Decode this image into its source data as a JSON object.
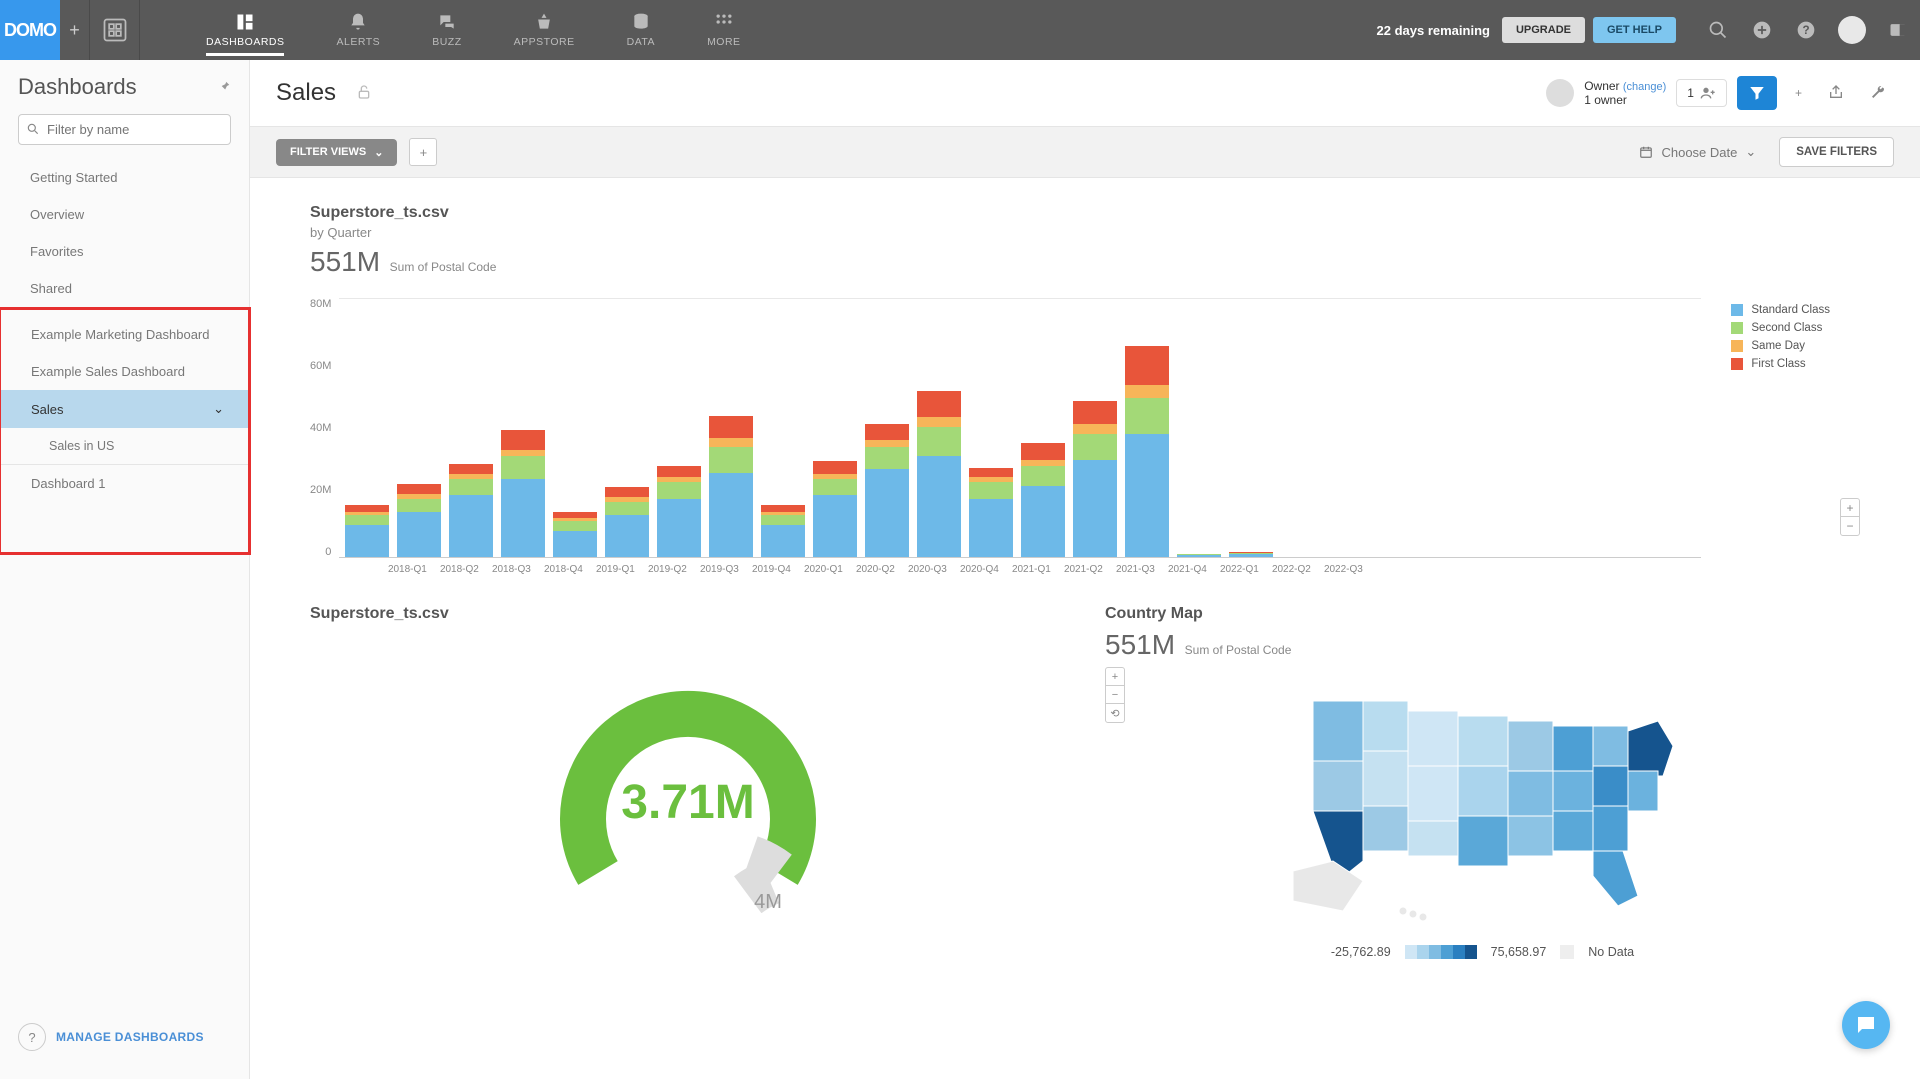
{
  "topnav": {
    "logo": "DOMO",
    "items": [
      "DASHBOARDS",
      "ALERTS",
      "BUZZ",
      "APPSTORE",
      "DATA",
      "MORE"
    ],
    "trial": "22 days remaining",
    "upgrade": "UPGRADE",
    "gethelp": "GET HELP"
  },
  "sidebar": {
    "title": "Dashboards",
    "filter_placeholder": "Filter by name",
    "items_top": [
      "Getting Started",
      "Overview",
      "Favorites",
      "Shared"
    ],
    "items_box": [
      {
        "label": "Example Marketing Dashboard"
      },
      {
        "label": "Example Sales Dashboard"
      },
      {
        "label": "Sales",
        "selected": true,
        "expand": true
      },
      {
        "label": "Sales in US",
        "sub": true
      },
      {
        "label": "Dashboard 1"
      }
    ],
    "manage": "MANAGE DASHBOARDS"
  },
  "page": {
    "title": "Sales",
    "owner_label": "Owner",
    "owner_change": "(change)",
    "owner_count_text": "1 owner",
    "count": "1",
    "filter_views": "FILTER VIEWS",
    "choose_date": "Choose Date",
    "save_filters": "SAVE FILTERS"
  },
  "chart_data": {
    "type": "bar",
    "title": "Superstore_ts.csv",
    "subtitle": "by Quarter",
    "headline_value": "551M",
    "headline_label": "Sum of Postal Code",
    "ylabel": "",
    "ylim": [
      0,
      80
    ],
    "y_ticks": [
      "80M",
      "60M",
      "40M",
      "20M",
      "0"
    ],
    "y_max": 80,
    "categories": [
      "2018-Q1",
      "2018-Q2",
      "2018-Q3",
      "2018-Q4",
      "2019-Q1",
      "2019-Q2",
      "2019-Q3",
      "2019-Q4",
      "2020-Q1",
      "2020-Q2",
      "2020-Q3",
      "2020-Q4",
      "2021-Q1",
      "2021-Q2",
      "2021-Q3",
      "2021-Q4",
      "2022-Q1",
      "2022-Q2",
      "2022-Q3"
    ],
    "series": [
      {
        "name": "Standard Class",
        "color": "#6db9e8",
        "values": [
          10,
          14,
          19,
          24,
          8,
          13,
          18,
          26,
          10,
          19,
          27,
          31,
          18,
          22,
          30,
          38,
          0.5,
          0.8,
          0
        ]
      },
      {
        "name": "Second Class",
        "color": "#a3d977",
        "values": [
          3,
          4,
          5,
          7,
          3,
          4,
          5,
          8,
          3,
          5,
          7,
          9,
          5,
          6,
          8,
          11,
          0.3,
          0.4,
          0
        ]
      },
      {
        "name": "Same Day",
        "color": "#f7b559",
        "values": [
          1,
          1.5,
          1.5,
          2,
          1,
          1.5,
          1.5,
          2.5,
          1,
          1.5,
          2,
          3,
          1.5,
          2,
          3,
          4,
          0.1,
          0.1,
          0
        ]
      },
      {
        "name": "First Class",
        "color": "#e8553a",
        "values": [
          2,
          3,
          3,
          6,
          2,
          3,
          3.5,
          7,
          2,
          4,
          5,
          8,
          3,
          5,
          7,
          12,
          0.1,
          0.2,
          0
        ]
      }
    ]
  },
  "gauge": {
    "title": "Superstore_ts.csv",
    "value": "3.71M",
    "total": "4M"
  },
  "map": {
    "title": "Country Map",
    "headline_value": "551M",
    "headline_label": "Sum of Postal Code",
    "legend_min": "-25,762.89",
    "legend_max": "75,658.97",
    "nodata": "No Data",
    "gradient": [
      "#cfe6f5",
      "#aad4ed",
      "#7fbce2",
      "#4d9fd4",
      "#2a7fc0",
      "#15548e"
    ]
  }
}
